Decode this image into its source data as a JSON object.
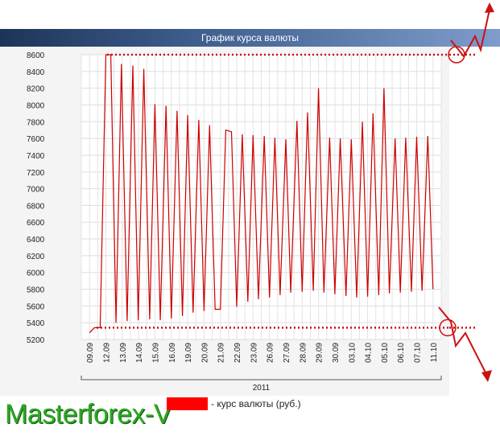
{
  "header": {
    "title": "График курса валюты"
  },
  "brand": {
    "text": "Masterforex-V"
  },
  "legend": {
    "label": "- курс валюты (руб.)",
    "color": "#ff0000"
  },
  "chart_data": {
    "type": "line",
    "title": "График курса валюты",
    "xlabel": "2011",
    "ylabel": "",
    "ylim": [
      5200,
      8600
    ],
    "yticks": [
      5200,
      5400,
      5600,
      5800,
      6000,
      6200,
      6400,
      6600,
      6800,
      7000,
      7200,
      7400,
      7600,
      7800,
      8000,
      8200,
      8400,
      8600
    ],
    "categories": [
      "09.09",
      "12.09",
      "13.09",
      "14.09",
      "15.09",
      "16.09",
      "19.09",
      "20.09",
      "21.09",
      "22.09",
      "23.09",
      "26.09",
      "27.09",
      "28.09",
      "29.09",
      "30.09",
      "03.10",
      "04.10",
      "05.10",
      "06.10",
      "07.10",
      "11.10"
    ],
    "grid": true,
    "series": [
      {
        "name": "курс валюты (руб.)",
        "color": "#cc0000",
        "x": [
          0.0,
          0.3,
          0.65,
          1.0,
          1.3,
          1.62,
          1.95,
          2.3,
          2.65,
          2.98,
          3.32,
          3.68,
          4.0,
          4.33,
          4.68,
          5.0,
          5.35,
          5.68,
          6.0,
          6.33,
          6.68,
          7.0,
          7.34,
          7.68,
          8.0,
          8.33,
          8.68,
          9.0,
          9.34,
          9.68,
          10.0,
          10.33,
          10.68,
          11.0,
          11.33,
          11.65,
          12.0,
          12.3,
          12.68,
          13.0,
          13.33,
          13.68,
          14.0,
          14.33,
          14.68,
          15.0,
          15.33,
          15.68,
          16.0,
          16.33,
          16.68,
          17.0,
          17.33,
          17.68,
          18.0,
          18.33,
          18.68,
          19.0,
          19.33,
          19.68,
          20.0,
          20.33,
          20.68,
          21.0
        ],
        "values": [
          5280,
          5340,
          5340,
          8600,
          8600,
          5400,
          8490,
          5420,
          8470,
          5430,
          8430,
          5440,
          8010,
          5430,
          7990,
          5450,
          7930,
          5480,
          7880,
          5520,
          7820,
          5540,
          7760,
          5560,
          5560,
          7700,
          7680,
          5590,
          7650,
          5650,
          7640,
          5680,
          7630,
          5700,
          7610,
          5730,
          7590,
          5760,
          7810,
          5770,
          7910,
          5780,
          8200,
          5760,
          7610,
          5740,
          7600,
          5720,
          7590,
          5700,
          7800,
          5710,
          7900,
          5730,
          8200,
          5750,
          7600,
          5760,
          7610,
          5770,
          7620,
          5780,
          7630,
          5800
        ],
        "values_note": ""
      }
    ],
    "annotations": {
      "max_line": 8600,
      "min_line": 5340
    }
  }
}
